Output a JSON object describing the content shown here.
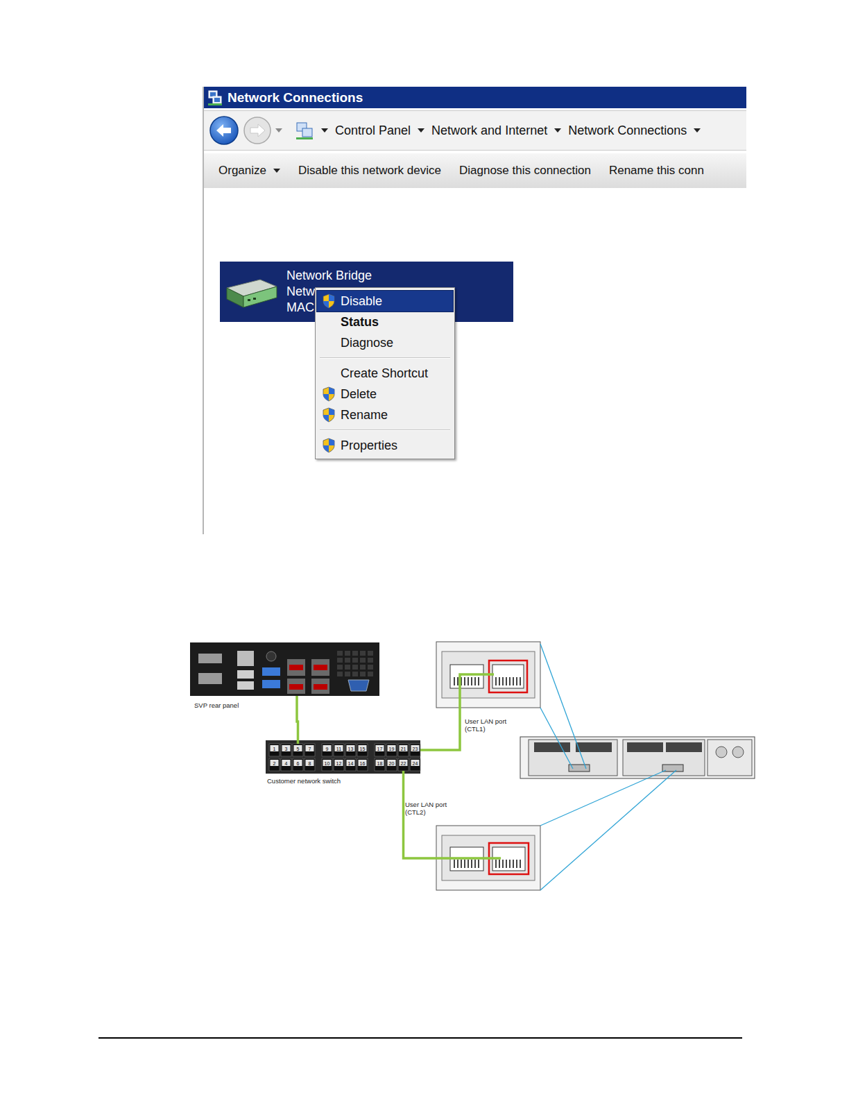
{
  "window": {
    "title": "Network Connections"
  },
  "breadcrumb": [
    "Control Panel",
    "Network and Internet",
    "Network Connections"
  ],
  "toolbar": [
    {
      "label": "Organize",
      "dropdown": true
    },
    {
      "label": "Disable this network device",
      "dropdown": false
    },
    {
      "label": "Diagnose this connection",
      "dropdown": false
    },
    {
      "label": "Rename this conn",
      "dropdown": false
    }
  ],
  "connection": {
    "name": "Network Bridge",
    "lines": [
      "Netw",
      "MAC"
    ],
    "selected": true
  },
  "context_menu": [
    {
      "kind": "item",
      "label": "Disable",
      "shield": true,
      "bold": false,
      "selected": true
    },
    {
      "kind": "item",
      "label": "Status",
      "shield": false,
      "bold": true,
      "selected": false
    },
    {
      "kind": "item",
      "label": "Diagnose",
      "shield": false,
      "bold": false,
      "selected": false
    },
    {
      "kind": "separator",
      "selected": false
    },
    {
      "kind": "item",
      "label": "Create Shortcut",
      "shield": false,
      "bold": false,
      "selected": false
    },
    {
      "kind": "item",
      "label": "Delete",
      "shield": true,
      "bold": false,
      "selected": false
    },
    {
      "kind": "item",
      "label": "Rename",
      "shield": true,
      "bold": false,
      "selected": false
    },
    {
      "kind": "separator",
      "selected": false
    },
    {
      "kind": "item",
      "label": "Properties",
      "shield": true,
      "bold": false,
      "selected": false
    }
  ],
  "diagram": {
    "svp": {
      "label": "SVP rear panel",
      "port": "5"
    },
    "switch": {
      "label": "Customer network switch",
      "ports": [
        "1",
        "2",
        "3",
        "4",
        "5",
        "6",
        "7",
        "8",
        "9",
        "10",
        "11",
        "12",
        "13",
        "14",
        "15",
        "16",
        "17",
        "18",
        "19",
        "20",
        "21",
        "22",
        "23",
        "24"
      ]
    },
    "controllers": [
      {
        "label": "User LAN port",
        "tag": "(CTL1)",
        "port": "23"
      },
      {
        "label": "User LAN port",
        "tag": "(CTL2)",
        "port": "22"
      }
    ]
  }
}
